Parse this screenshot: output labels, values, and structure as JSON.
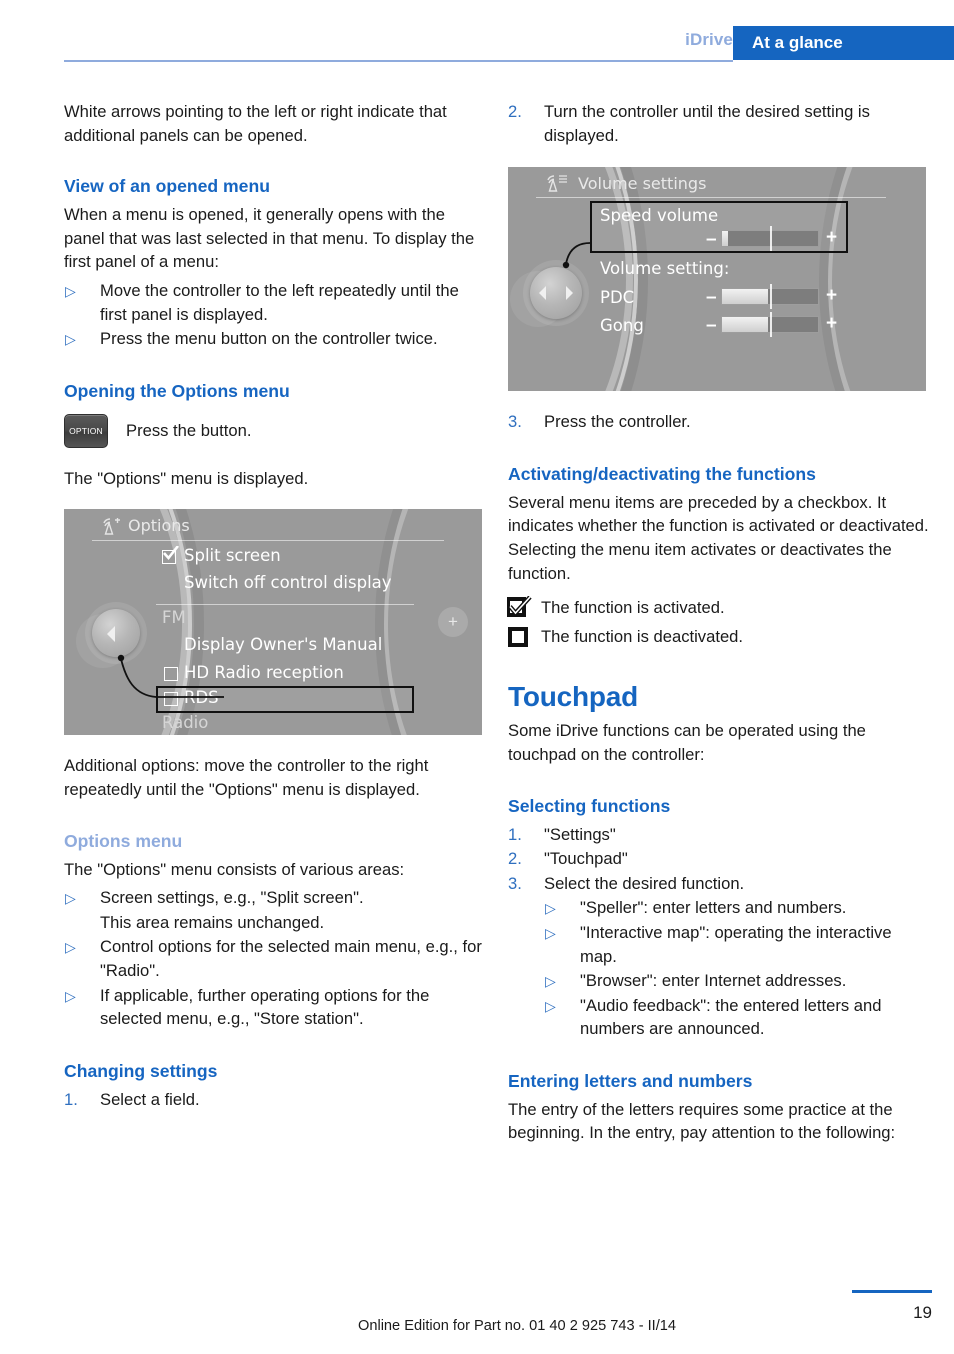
{
  "header": {
    "book_label": "iDrive",
    "tab_label": "At a glance"
  },
  "left_column": {
    "intro_paragraph": "White arrows pointing to the left or right indicate that additional panels can be opened.",
    "heading_view": "View of an opened menu",
    "view_paragraph": "When a menu is opened, it generally opens with the panel that was last selected in that menu. To display the first panel of a menu:",
    "view_bullets": [
      "Move the controller to the left repeatedly until the first panel is displayed.",
      "Press the menu button on the controller twice."
    ],
    "heading_opening": "Opening the Options menu",
    "option_button_label": "OPTION",
    "press_button_text": "Press the button.",
    "options_displayed_text": "The \"Options\" menu is displayed.",
    "additional_options_paragraph": "Additional options: move the controller to the right repeatedly until the \"Options\" menu is displayed.",
    "heading_options_menu": "Options menu",
    "options_menu_paragraph": "The \"Options\" menu consists of various areas:",
    "options_menu_bullets": [
      {
        "text": "Screen settings, e.g., \"Split screen\".",
        "continuation": "This area remains unchanged."
      },
      {
        "text": "Control options for the selected main menu, e.g., for \"Radio\".",
        "continuation": ""
      },
      {
        "text": "If applicable, further operating options for the selected menu, e.g., \"Store station\".",
        "continuation": ""
      }
    ],
    "heading_changing": "Changing settings",
    "changing_steps": [
      {
        "number": "1.",
        "text": "Select a field."
      }
    ]
  },
  "options_screenshot": {
    "title": "Options",
    "title_icon": "antenna-signal-icon",
    "items": [
      {
        "label": "Split screen",
        "checkbox": "checked"
      },
      {
        "label": "Switch off control display",
        "checkbox": "none"
      },
      {
        "label": "FM",
        "checkbox": "none",
        "style": "dim"
      },
      {
        "label": "Display Owner's Manual",
        "checkbox": "none"
      },
      {
        "label": "HD Radio reception",
        "checkbox": "unchecked"
      },
      {
        "label": "RDS",
        "checkbox": "unchecked",
        "selected": true
      },
      {
        "label": "Radio",
        "checkbox": "none",
        "style": "dim"
      }
    ],
    "controller_arrow": "left-arrow-icon",
    "right_button": "plus-icon"
  },
  "right_column": {
    "step2": {
      "number": "2.",
      "text": "Turn the controller until the desired setting is displayed."
    },
    "step3": {
      "number": "3.",
      "text": "Press the controller."
    },
    "heading_activating": "Activating/deactivating the functions",
    "activating_paragraph": "Several menu items are preceded by a checkbox. It indicates whether the function is activated or deactivated. Selecting the menu item activates or deactivates the function.",
    "legend": [
      {
        "icon": "checkbox-checked-icon",
        "text": "The function is activated."
      },
      {
        "icon": "checkbox-unchecked-icon",
        "text": "The function is deactivated."
      }
    ],
    "heading_touchpad": "Touchpad",
    "touchpad_paragraph": "Some iDrive functions can be operated using the touchpad on the controller:",
    "heading_selecting": "Selecting functions",
    "selecting_steps": [
      {
        "number": "1.",
        "text": "\"Settings\""
      },
      {
        "number": "2.",
        "text": "\"Touchpad\""
      },
      {
        "number": "3.",
        "text": "Select the desired function."
      }
    ],
    "selecting_bullets": [
      "\"Speller\": enter letters and numbers.",
      "\"Interactive map\": operating the interactive map.",
      "\"Browser\": enter Internet addresses.",
      "\"Audio feedback\": the entered letters and numbers are announced."
    ],
    "heading_entering": "Entering letters and numbers",
    "entering_paragraph": "The entry of the letters requires some practice at the beginning. In the entry, pay attention to the following:"
  },
  "volume_screenshot": {
    "title": "Volume settings",
    "title_icon": "antenna-list-icon",
    "selected_label": "Speed volume",
    "section_label": "Volume setting:",
    "rows": [
      {
        "label": "PDC",
        "minus": "–",
        "plus": "+",
        "fill_percent": 48
      },
      {
        "label": "Gong",
        "minus": "–",
        "plus": "+",
        "fill_percent": 48
      }
    ],
    "speed_volume_slider": {
      "minus": "–",
      "plus": "+",
      "fill_percent": 6
    },
    "controller_arrows": "left-right-arrow-icon"
  },
  "footer": {
    "edition_text": "Online Edition for Part no. 01 40 2 925 743 - II/14",
    "page_number": "19"
  },
  "colors": {
    "heading_blue": "#1665c1",
    "pale_blue": "#8fabdd",
    "tab_blue": "#1565c0"
  }
}
